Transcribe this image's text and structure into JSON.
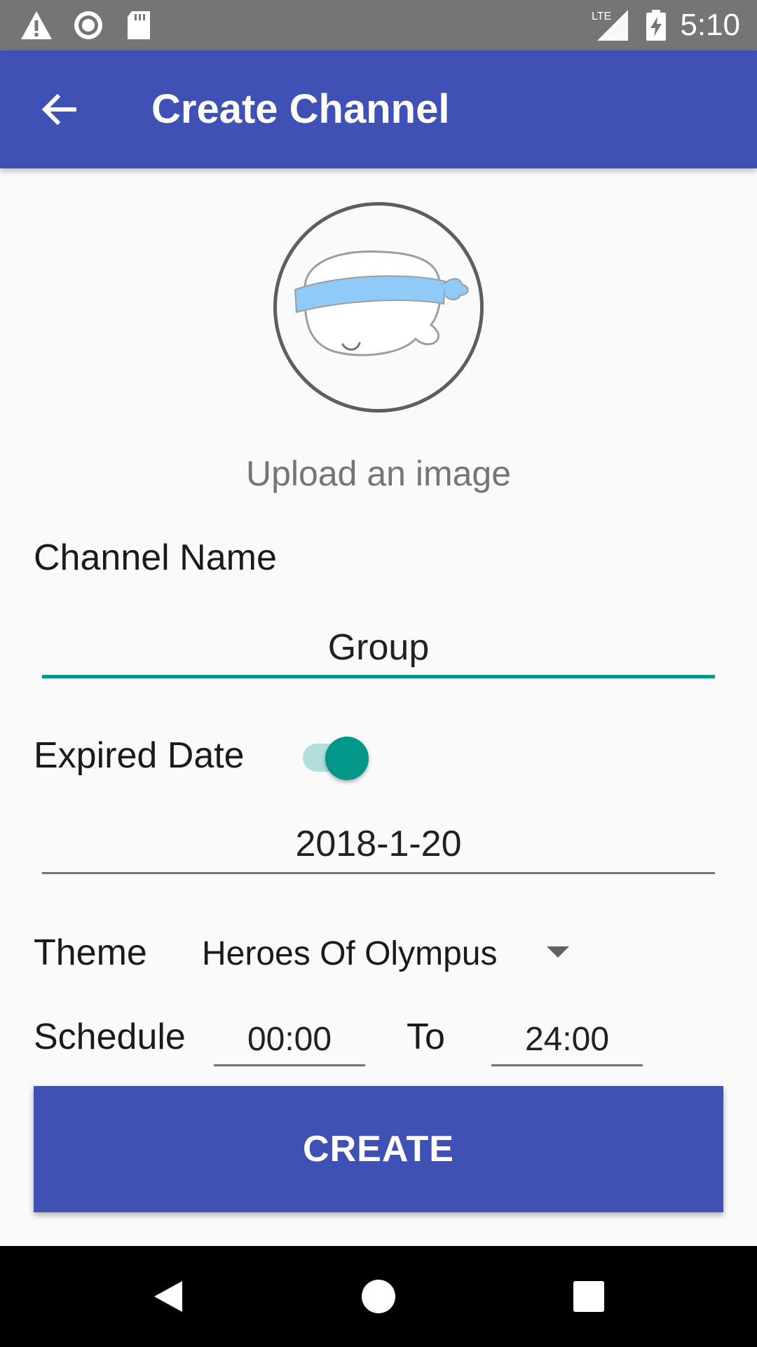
{
  "status_bar": {
    "icons": [
      "warning-icon",
      "sync-icon",
      "sd-card-icon",
      "lte-signal-icon",
      "battery-charging-icon"
    ],
    "network_label": "LTE",
    "time": "5:10"
  },
  "app_bar": {
    "title": "Create Channel",
    "back_icon": "arrow-back-icon"
  },
  "avatar": {
    "icon": "blindfold-character-avatar",
    "upload_label": "Upload an image"
  },
  "form": {
    "channel_name_label": "Channel Name",
    "channel_name_value": "Group",
    "expired_date_label": "Expired Date",
    "expired_date_enabled": true,
    "expired_date_value": "2018-1-20",
    "theme_label": "Theme",
    "theme_value": "Heroes Of Olympus",
    "schedule_label": "Schedule",
    "schedule_from": "00:00",
    "schedule_to_label": "To",
    "schedule_to": "24:00"
  },
  "actions": {
    "create_label": "CREATE"
  },
  "nav_bar": {
    "icons": [
      "nav-back-icon",
      "nav-home-icon",
      "nav-recents-icon"
    ]
  },
  "colors": {
    "primary": "#3f51b5",
    "accent": "#009688",
    "status_bar": "#757575"
  }
}
